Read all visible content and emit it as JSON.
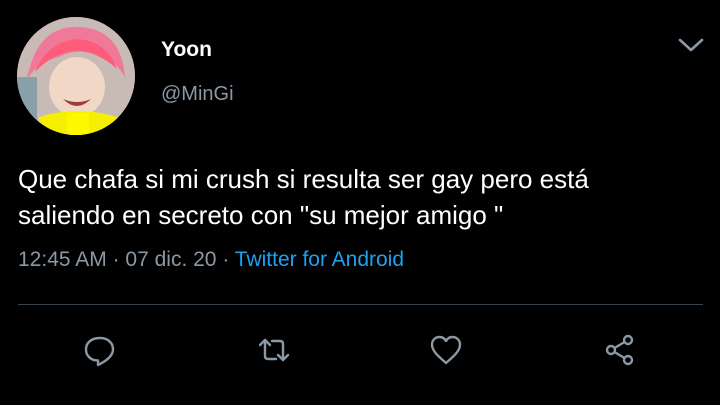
{
  "tweet": {
    "display_name": "Yoon",
    "username": "@MinGi",
    "line1": "Que chafa si mi crush si resulta ser gay pero está",
    "line2": "saliendo en secreto con \"su mejor amigo \"",
    "time": "12:45 AM",
    "sep1": " · ",
    "date": "07 dic. 20",
    "sep2": " · ",
    "source": "Twitter for Android"
  },
  "icons": {
    "more": "chevron-down-icon",
    "reply": "comment-icon",
    "retweet": "retweet-icon",
    "like": "heart-icon",
    "share": "share-icon"
  },
  "colors": {
    "background": "#000000",
    "text": "#ffffff",
    "secondary_text": "#8b98a5",
    "link": "#1da1f2",
    "divider": "#38444d"
  }
}
